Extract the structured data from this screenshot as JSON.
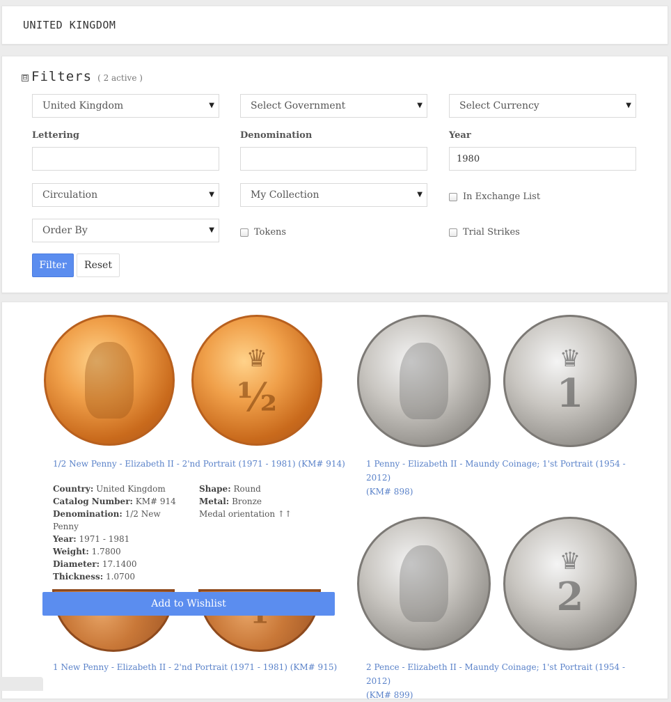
{
  "header": {
    "title": "UNITED KINGDOM"
  },
  "filters": {
    "title": "Filters",
    "active": "( 2 active )",
    "toggle_symbol": "⊟",
    "country_select": "United Kingdom",
    "government_select": "Select Government",
    "currency_select": "Select Currency",
    "lettering_label": "Lettering",
    "lettering_value": "",
    "denomination_label": "Denomination",
    "denomination_value": "",
    "year_label": "Year",
    "year_value": "1980",
    "circulation_select": "Circulation",
    "collection_select": "My Collection",
    "exchange_label": "In Exchange List",
    "order_select": "Order By",
    "tokens_label": "Tokens",
    "trial_label": "Trial Strikes",
    "filter_button": "Filter",
    "reset_button": "Reset",
    "arrow": "▼"
  },
  "results": [
    {
      "title": "1/2 New Penny - Elizabeth II - 2'nd Portrait (1971 - 1981) (KM# 914)",
      "reverse_text": "½",
      "details": {
        "country_label": "Country:",
        "country": "United Kingdom",
        "catalog_label": "Catalog Number:",
        "catalog": "KM# 914",
        "denomination_label": "Denomination:",
        "denomination": "1/2 New",
        "denomination_cont": "Penny",
        "year_label": "Year:",
        "year": "1971 - 1981",
        "weight_label": "Weight:",
        "weight": "1.7800",
        "diameter_label": "Diameter:",
        "diameter": "17.1400",
        "thickness_label": "Thickness:",
        "thickness": "1.0700",
        "shape_label": "Shape:",
        "shape": "Round",
        "metal_label": "Metal:",
        "metal": "Bronze",
        "orientation": "Medal orientation ↑↑"
      },
      "wishlist_button": "Add to Wishlist"
    },
    {
      "title": "1 Penny - Elizabeth II - Maundy Coinage; 1'st Portrait (1954 - 2012)",
      "title_cont": "(KM# 898)",
      "reverse_text": "1"
    },
    {
      "title": "1 New Penny - Elizabeth II - 2'nd Portrait (1971 - 1981) (KM# 915)",
      "reverse_text": "1"
    },
    {
      "title": "2 Pence - Elizabeth II - Maundy Coinage; 1'st Portrait (1954 - 2012)",
      "title_cont": "(KM# 899)",
      "reverse_text": "2"
    }
  ],
  "colors": {
    "accent": "#5b8def",
    "link": "#5a82c9"
  }
}
